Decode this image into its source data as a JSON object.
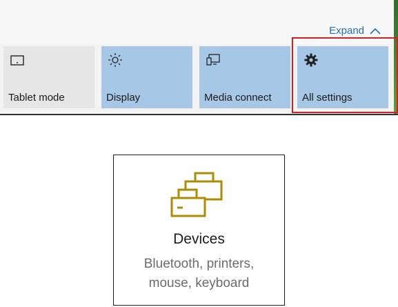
{
  "action_center": {
    "expand_label": "Expand",
    "tiles": [
      {
        "label": "Tablet mode",
        "icon": "tablet-mode-icon",
        "active": false
      },
      {
        "label": "Display",
        "icon": "brightness-icon",
        "active": true
      },
      {
        "label": "Media connect",
        "icon": "media-connect-icon",
        "active": true
      },
      {
        "label": "All settings",
        "icon": "gear-icon",
        "active": true
      }
    ],
    "tile_active_color": "#a7c7e7",
    "tile_inactive_color": "#e6e6e6",
    "highlight_color": "#d21f1f"
  },
  "devices_card": {
    "icon": "printer-devices-icon",
    "icon_color": "#b08a00",
    "title": "Devices",
    "description_line1": "Bluetooth, printers,",
    "description_line2": "mouse, keyboard"
  }
}
